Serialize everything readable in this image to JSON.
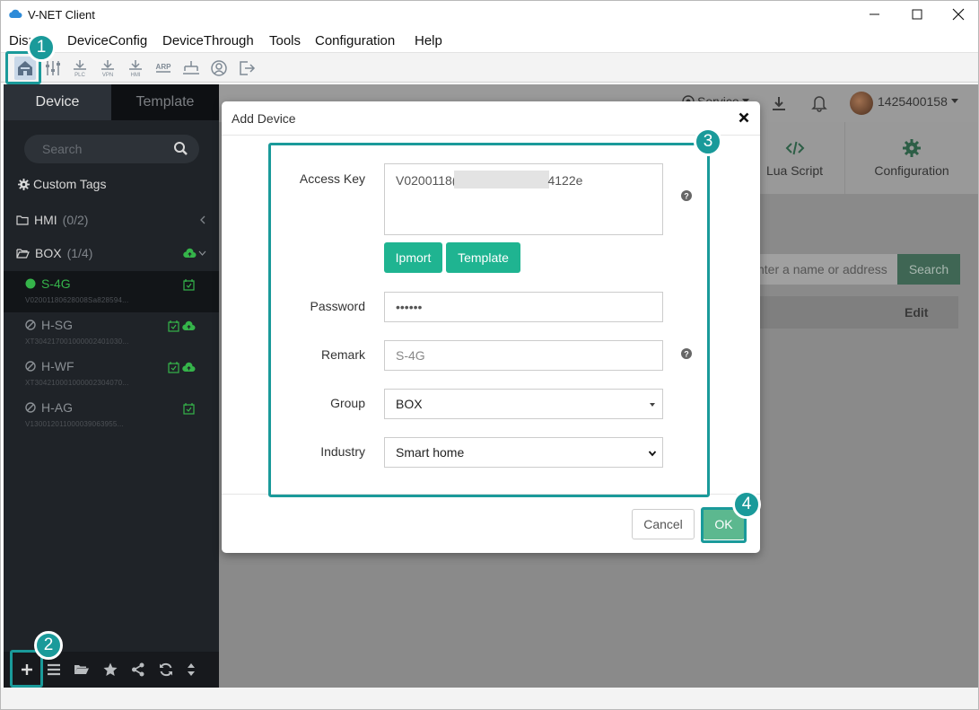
{
  "window": {
    "title": "V-NET Client",
    "brand_color": "#2e8bd8"
  },
  "menu": {
    "items": [
      "Disp",
      "DeviceConfig",
      "DeviceThrough",
      "Tools",
      "Configuration",
      "Help"
    ]
  },
  "toolbar": {
    "icons": [
      "home-icon",
      "tune-icon",
      "plc-icon",
      "vpn-icon",
      "hmi-icon",
      "arp-icon",
      "network-icon",
      "user-icon",
      "logout-icon"
    ],
    "labels": {
      "plc": "PLC",
      "vpn": "VPN",
      "hmi": "HMI",
      "arp": "ARP"
    }
  },
  "sidebar": {
    "tabs": [
      "Device",
      "Template"
    ],
    "search_placeholder": "Search",
    "custom_tags": "Custom Tags",
    "groups": [
      {
        "name": "HMI",
        "count": "(0/2)"
      },
      {
        "name": "BOX",
        "count": "(1/4)"
      }
    ],
    "devices": [
      {
        "name": "S-4G",
        "sub": "V02001180628008Sa828594...",
        "status": "online"
      },
      {
        "name": "H-SG",
        "sub": "XT304217001000002401030...",
        "status": "disabled"
      },
      {
        "name": "H-WF",
        "sub": "XT304210001000002304070...",
        "status": "disabled"
      },
      {
        "name": "H-AG",
        "sub": "V130012011000039063955...",
        "status": "disabled"
      }
    ],
    "online_color": "#35b44a"
  },
  "main": {
    "service": "Service",
    "user_id": "1425400158",
    "cards": [
      "Lua Script",
      "Configuration"
    ],
    "search_placeholder": "nter a name or address",
    "search_button": "Search",
    "edit_label": "Edit"
  },
  "dialog": {
    "title": "Add Device",
    "access_key_label": "Access Key",
    "access_key_prefix": "V0200118(",
    "access_key_suffix": "4122e",
    "import_button": "Ipmort",
    "template_button": "Template",
    "password_label": "Password",
    "password_value": "••••••",
    "remark_label": "Remark",
    "remark_placeholder": "S-4G",
    "group_label": "Group",
    "group_value": "BOX",
    "industry_label": "Industry",
    "industry_value": "Smart home",
    "cancel_button": "Cancel",
    "ok_button": "OK",
    "accent_color": "#1fb491"
  },
  "annotations": [
    "1",
    "2",
    "3",
    "4"
  ]
}
